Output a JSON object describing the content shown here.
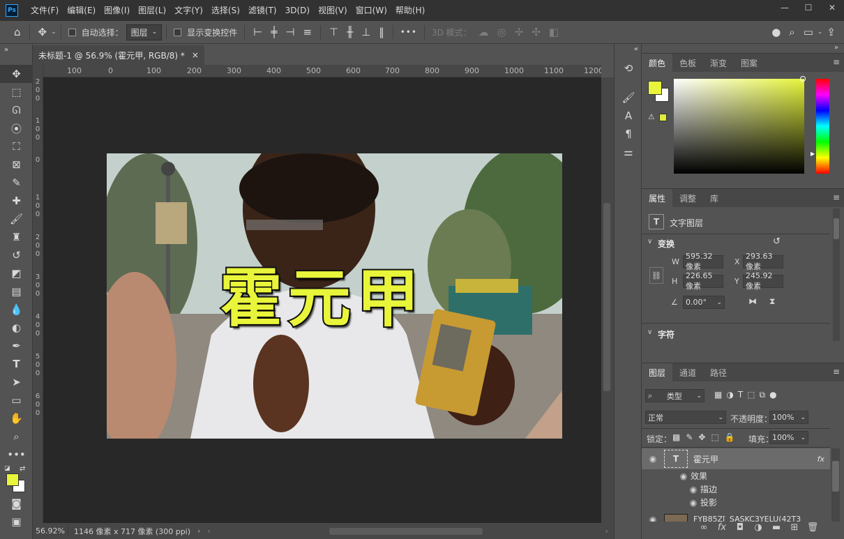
{
  "app": {
    "logo_text": "Ps",
    "menu": [
      "文件(F)",
      "编辑(E)",
      "图像(I)",
      "图层(L)",
      "文字(Y)",
      "选择(S)",
      "滤镜(T)",
      "3D(D)",
      "视图(V)",
      "窗口(W)",
      "帮助(H)"
    ],
    "window_controls": {
      "minimize": "—",
      "maximize": "☐",
      "close": "✕"
    }
  },
  "options_bar": {
    "auto_select_label": "自动选择：",
    "auto_select_value": "图层",
    "show_transform_label": "显示变换控件",
    "mode_3d_label": "3D 模式：",
    "more_label": "•••"
  },
  "document": {
    "tab_title": "未标题-1 @ 56.9% (霍元甲, RGB/8) *",
    "tab_close": "×",
    "ruler_top": [
      "100",
      "0",
      "100",
      "200",
      "300",
      "400",
      "500",
      "600",
      "700",
      "800",
      "900",
      "1000",
      "1100",
      "1200"
    ],
    "ruler_left": [
      "2",
      "0",
      "0",
      "1",
      "0",
      "0",
      "0",
      "1",
      "0",
      "0",
      "2",
      "0",
      "0",
      "3",
      "0",
      "0",
      "4",
      "0",
      "0",
      "5",
      "0",
      "0",
      "6",
      "0",
      "0"
    ],
    "canvas_text": "霍元甲",
    "zoom": "56.92%",
    "doc_info": "1146 像素 x 717 像素 (300 ppi)"
  },
  "color_panel": {
    "tabs": [
      "颜色",
      "色板",
      "渐变",
      "图案"
    ],
    "foreground": "#e8f53a",
    "background": "#ffffff",
    "hue_color": "#e6f53a"
  },
  "properties_panel": {
    "tabs": [
      "属性",
      "调整",
      "库"
    ],
    "layer_type": "文字图层",
    "transform_title": "变换",
    "w_label": "W",
    "w_value": "595.32 像素",
    "h_label": "H",
    "h_value": "226.65 像素",
    "x_label": "X",
    "x_value": "293.63 像素",
    "y_label": "Y",
    "y_value": "245.92 像素",
    "angle_value": "0.00°",
    "character_title": "字符"
  },
  "layers_panel": {
    "tabs": [
      "图层",
      "通道",
      "路径"
    ],
    "filter_label": "类型",
    "blend_mode": "正常",
    "opacity_label": "不透明度：",
    "opacity_value": "100%",
    "lock_label": "锁定：",
    "fill_label": "填充：",
    "fill_value": "100%",
    "layers": [
      {
        "name": "霍元甲",
        "kind": "text",
        "fx": "fx"
      },
      {
        "name": "效果",
        "kind": "effects"
      },
      {
        "name": "描边",
        "kind": "effect"
      },
      {
        "name": "投影",
        "kind": "effect"
      },
      {
        "name": "FYB85Z[_SASKC3YELU(42T3",
        "kind": "image"
      }
    ]
  }
}
